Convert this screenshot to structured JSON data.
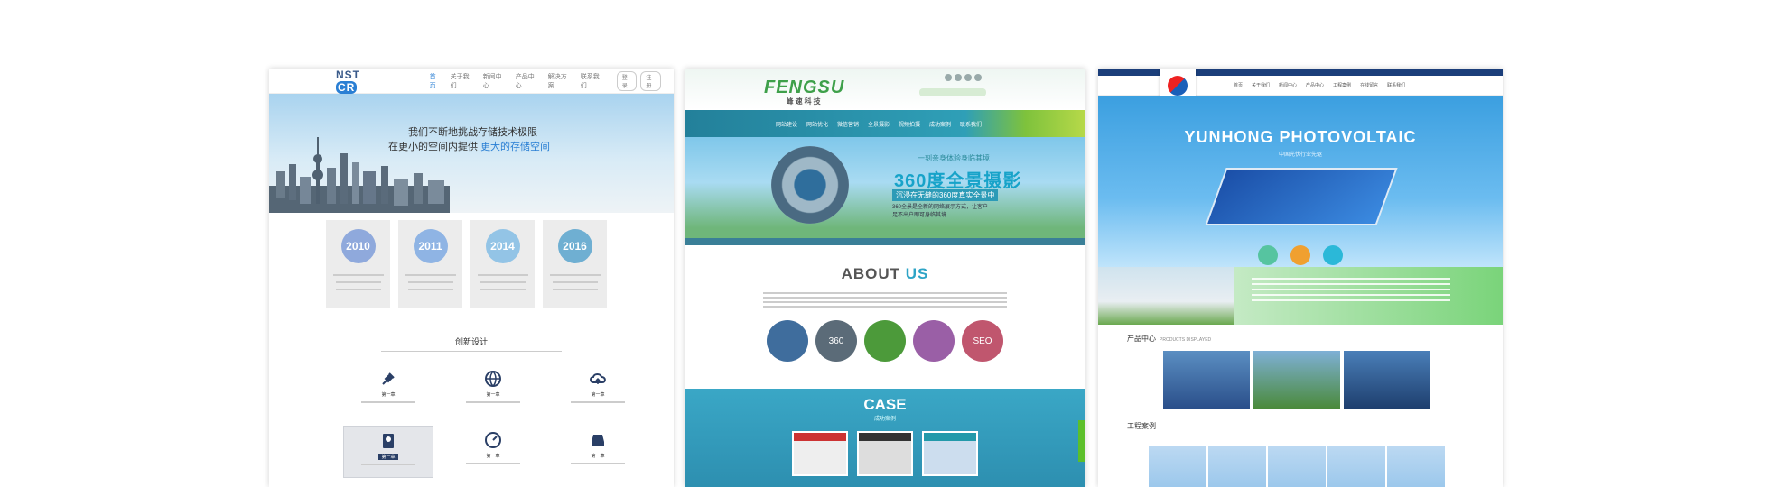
{
  "card1": {
    "logo": "NST",
    "logo_badge": "CR",
    "nav": [
      "首页",
      "关于我们",
      "新闻中心",
      "产品中心",
      "解决方案",
      "联系我们"
    ],
    "nav_buttons": [
      "登录",
      "注册"
    ],
    "hero_line1": "我们不断地挑战存储技术极限",
    "hero_line2": "在更小的空间内提供",
    "hero_highlight": "更大的存储空间",
    "years": [
      {
        "label": "2010",
        "color": "#8fa9dc"
      },
      {
        "label": "2011",
        "color": "#8fb4e4"
      },
      {
        "label": "2014",
        "color": "#93c4e6"
      },
      {
        "label": "2016",
        "color": "#6fafd2"
      }
    ],
    "section_title": "创新设计",
    "features": [
      {
        "icon": "plug-icon",
        "label": "第一章"
      },
      {
        "icon": "globe-icon",
        "label": "第一章"
      },
      {
        "icon": "cloud-upload-icon",
        "label": "第一章"
      },
      {
        "icon": "hard-disk-icon",
        "label": "第一章"
      },
      {
        "icon": "speedometer-icon",
        "label": "第一章"
      },
      {
        "icon": "server-icon",
        "label": "第一章"
      }
    ]
  },
  "card2": {
    "logo": "FENGSU",
    "logo_sub": "峰速科技",
    "nav": [
      "网站建设",
      "网站优化",
      "微信营销",
      "全景摄影",
      "视频拍摄",
      "成功案例",
      "联系我们"
    ],
    "banner_small": "一刻亲身体验身临其境",
    "banner_title": "360度全景摄影",
    "banner_tag": "沉浸在无缝的360度真实全景中",
    "banner_desc": "360全景是全新的网络展示方式，让客户足不出户即可身临其境",
    "about_a": "ABOUT",
    "about_b": "US",
    "circles": [
      {
        "text": "",
        "color": "#3f6d9d",
        "name": "wechat-icon"
      },
      {
        "text": "360",
        "color": "#5b6b78",
        "name": "panorama-360-icon"
      },
      {
        "text": "",
        "color": "#4c9a3a",
        "name": "monitor-icon"
      },
      {
        "text": "",
        "color": "#9a5fa6",
        "name": "mobile-phone-icon"
      },
      {
        "text": "SEO",
        "color": "#c0566e",
        "name": "seo-icon"
      }
    ],
    "case_title": "CASE",
    "case_sub": "成功案例"
  },
  "card3": {
    "nav": [
      "首页",
      "关于我们",
      "新闻中心",
      "产品中心",
      "工程案例",
      "在线留言",
      "联系我们"
    ],
    "hero_title": "YUNHONG  PHOTOVOLTAIC",
    "hero_sub": "中国光伏行业先驱",
    "dots": [
      "#56c4a0",
      "#f0a030",
      "#2bb8d8"
    ],
    "products_title": "产品中心",
    "products_sub": "PRODUCTS DISPLAYED",
    "products": [
      "#5b8fc2",
      "#7fb0d6",
      "#4a7fb8"
    ],
    "engineering_title": "工程案例"
  }
}
